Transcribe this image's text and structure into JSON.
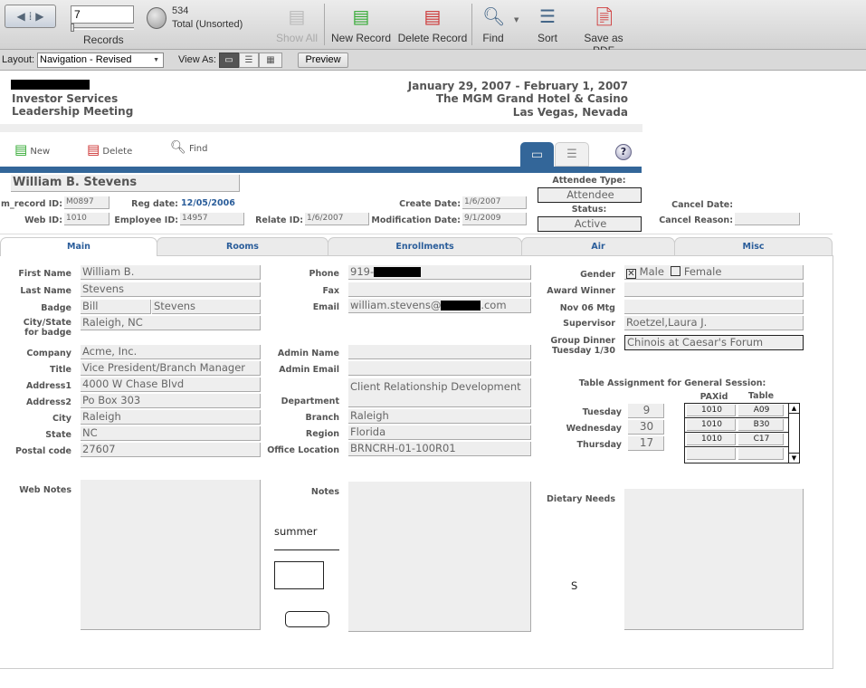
{
  "toolbar": {
    "record_number": "7",
    "records_label": "Records",
    "total": "534",
    "total_label": "Total (Unsorted)",
    "show_all": "Show All",
    "new_record": "New Record",
    "delete_record": "Delete Record",
    "find": "Find",
    "sort": "Sort",
    "save_pdf": "Save as PDF"
  },
  "layoutbar": {
    "layout_label": "Layout:",
    "layout_value": "Navigation - Revised",
    "view_as": "View As:",
    "preview": "Preview"
  },
  "header": {
    "org_line1": "Investor Services",
    "org_line2": "Leadership Meeting",
    "dates": "January 29, 2007 - February 1, 2007",
    "venue": "The MGM Grand Hotel & Casino",
    "city": "Las Vegas, Nevada"
  },
  "actions": {
    "new": "New",
    "delete": "Delete",
    "find": "Find",
    "help": "?"
  },
  "record": {
    "name": "William B. Stevens",
    "m_record_label": "m_record ID:",
    "m_record": "M0897",
    "reg_label": "Reg date:",
    "reg_date": "12/05/2006",
    "web_label": "Web ID:",
    "web_id": "1010",
    "emp_label": "Employee ID:",
    "emp_id": "14957",
    "relate_label": "Relate ID:",
    "relate_id": "1/6/2007",
    "create_label": "Create Date:",
    "create_date": "1/6/2007",
    "mod_label": "Modification Date:",
    "mod_date": "9/1/2009",
    "att_type_label": "Attendee Type:",
    "att_type": "Attendee",
    "status_label": "Status:",
    "status": "Active",
    "cancel_date_label": "Cancel Date:",
    "cancel_reason_label": "Cancel Reason:"
  },
  "tabs": [
    "Main",
    "Rooms",
    "Enrollments",
    "Air",
    "Misc"
  ],
  "left": {
    "first_name_l": "First Name",
    "first_name": "William B.",
    "last_name_l": "Last Name",
    "last_name": "Stevens",
    "badge_l": "Badge",
    "badge1": "Bill",
    "badge2": "Stevens",
    "city_badge_l1": "City/State",
    "city_badge_l2": "for badge",
    "city_badge": "Raleigh, NC",
    "company_l": "Company",
    "company": "Acme, Inc.",
    "title_l": "Title",
    "title": "Vice President/Branch Manager",
    "addr1_l": "Address1",
    "addr1": "4000 W Chase Blvd",
    "addr2_l": "Address2",
    "addr2": "Po Box 303",
    "city_l": "City",
    "city": "Raleigh",
    "state_l": "State",
    "state": "NC",
    "postal_l": "Postal code",
    "postal": "27607",
    "web_notes_l": "Web Notes"
  },
  "middle": {
    "phone_l": "Phone",
    "phone": "919-",
    "fax_l": "Fax",
    "email_l": "Email",
    "email_a": "william.stevens@",
    "email_b": ".com",
    "admin_name_l": "Admin Name",
    "admin_email_l": "Admin Email",
    "dept_l": "Department",
    "dept": "Client Relationship Development",
    "branch_l": "Branch",
    "branch": "Raleigh",
    "region_l": "Region",
    "region": "Florida",
    "office_l": "Office Location",
    "office": "BRNCRH-01-100R01",
    "notes_l": "Notes",
    "summer": "summer"
  },
  "right": {
    "gender_l": "Gender",
    "male": "Male",
    "female": "Female",
    "male_checked": true,
    "award_l": "Award Winner",
    "nov_l": "Nov 06 Mtg",
    "supervisor_l": "Supervisor",
    "supervisor": "Roetzel,Laura J.",
    "dinner_l1": "Group Dinner",
    "dinner_l2": "Tuesday 1/30",
    "dinner": "Chinois at Caesar's Forum",
    "table_title": "Table Assignment for General Session:",
    "pax_h": "PAXid",
    "table_h": "Table",
    "days": [
      {
        "day": "Tuesday",
        "val": "9"
      },
      {
        "day": "Wednesday",
        "val": "30"
      },
      {
        "day": "Thursday",
        "val": "17"
      }
    ],
    "rows": [
      {
        "pax": "1010",
        "table": "A09"
      },
      {
        "pax": "1010",
        "table": "B30"
      },
      {
        "pax": "1010",
        "table": "C17"
      },
      {
        "pax": "",
        "table": ""
      }
    ],
    "dietary_l": "Dietary Needs",
    "dietary_s": "S"
  }
}
